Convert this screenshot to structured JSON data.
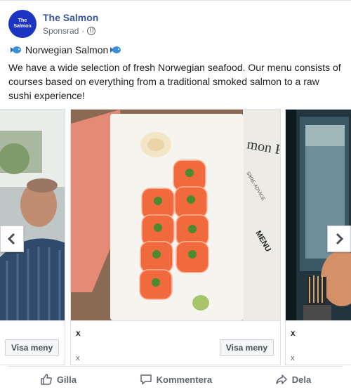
{
  "post": {
    "page_name": "The Salmon",
    "avatar_text": [
      "The",
      "Salmon"
    ],
    "sponsored": "Sponsrad",
    "separator": "·",
    "title_text": "Norwegian Salmon",
    "description": "We have a wide selection of fresh Norwegian seafood. Our menu consists of courses based on everything from a traditional smoked salmon to a raw sushi experience!"
  },
  "carousel": {
    "cards": [
      {
        "headline": "",
        "cta": "Visa meny",
        "desc": ""
      },
      {
        "headline": "x",
        "cta": "Visa meny",
        "desc": "x"
      },
      {
        "headline": "x",
        "cta": "",
        "desc": "x"
      }
    ],
    "menu_card_text": [
      "mon Pos",
      "SIKIE-ADVICE",
      "MENU",
      "SS MENU"
    ]
  },
  "actions": {
    "like": "Gilla",
    "comment": "Kommentera",
    "share": "Dela"
  },
  "colors": {
    "brand": "#1b34c2",
    "link": "#385898",
    "muted": "#606770",
    "salmon": "#f06a3e"
  }
}
